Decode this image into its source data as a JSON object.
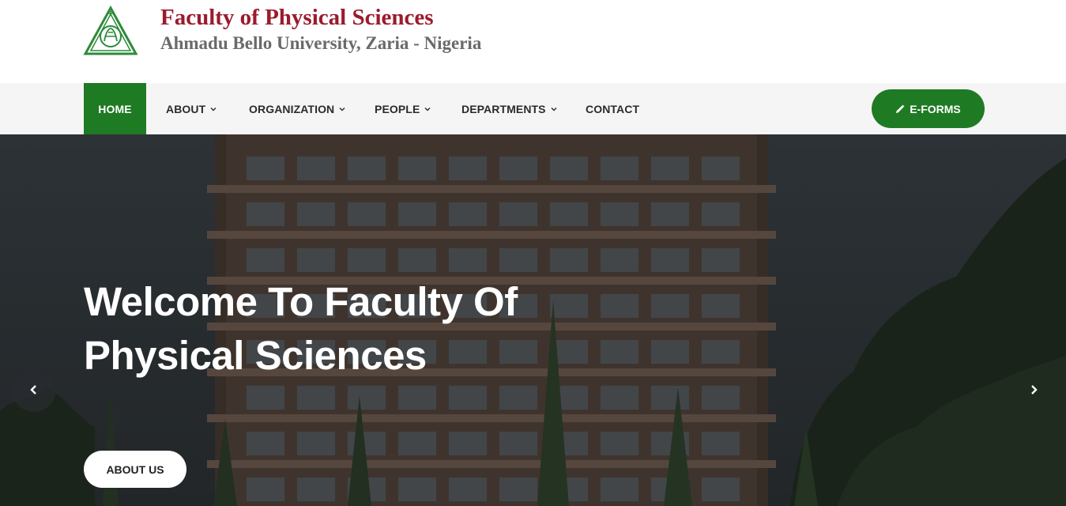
{
  "header": {
    "title": "Faculty of Physical Sciences",
    "subtitle": "Ahmadu Bello University, Zaria - Nigeria",
    "logo_icon": "abu-crest-logo"
  },
  "nav": {
    "items": [
      {
        "label": "HOME",
        "active": true,
        "dropdown": false
      },
      {
        "label": "ABOUT",
        "active": false,
        "dropdown": true
      },
      {
        "label": "ORGANIZATION",
        "active": false,
        "dropdown": true
      },
      {
        "label": "PEOPLE",
        "active": false,
        "dropdown": true
      },
      {
        "label": "DEPARTMENTS",
        "active": false,
        "dropdown": true
      },
      {
        "label": "CONTACT",
        "active": false,
        "dropdown": false
      }
    ],
    "cta_label": "E-FORMS",
    "cta_icon": "pencil-icon"
  },
  "hero": {
    "title": "Welcome To Faculty Of Physical Sciences",
    "button_label": "ABOUT US",
    "prev_icon": "chevron-left-icon",
    "next_icon": "chevron-right-icon"
  },
  "colors": {
    "brand_green": "#1f7a24",
    "brand_red": "#9b1b2c",
    "subtitle_gray": "#6a6a6a",
    "nav_bg": "#f5f5f5"
  }
}
